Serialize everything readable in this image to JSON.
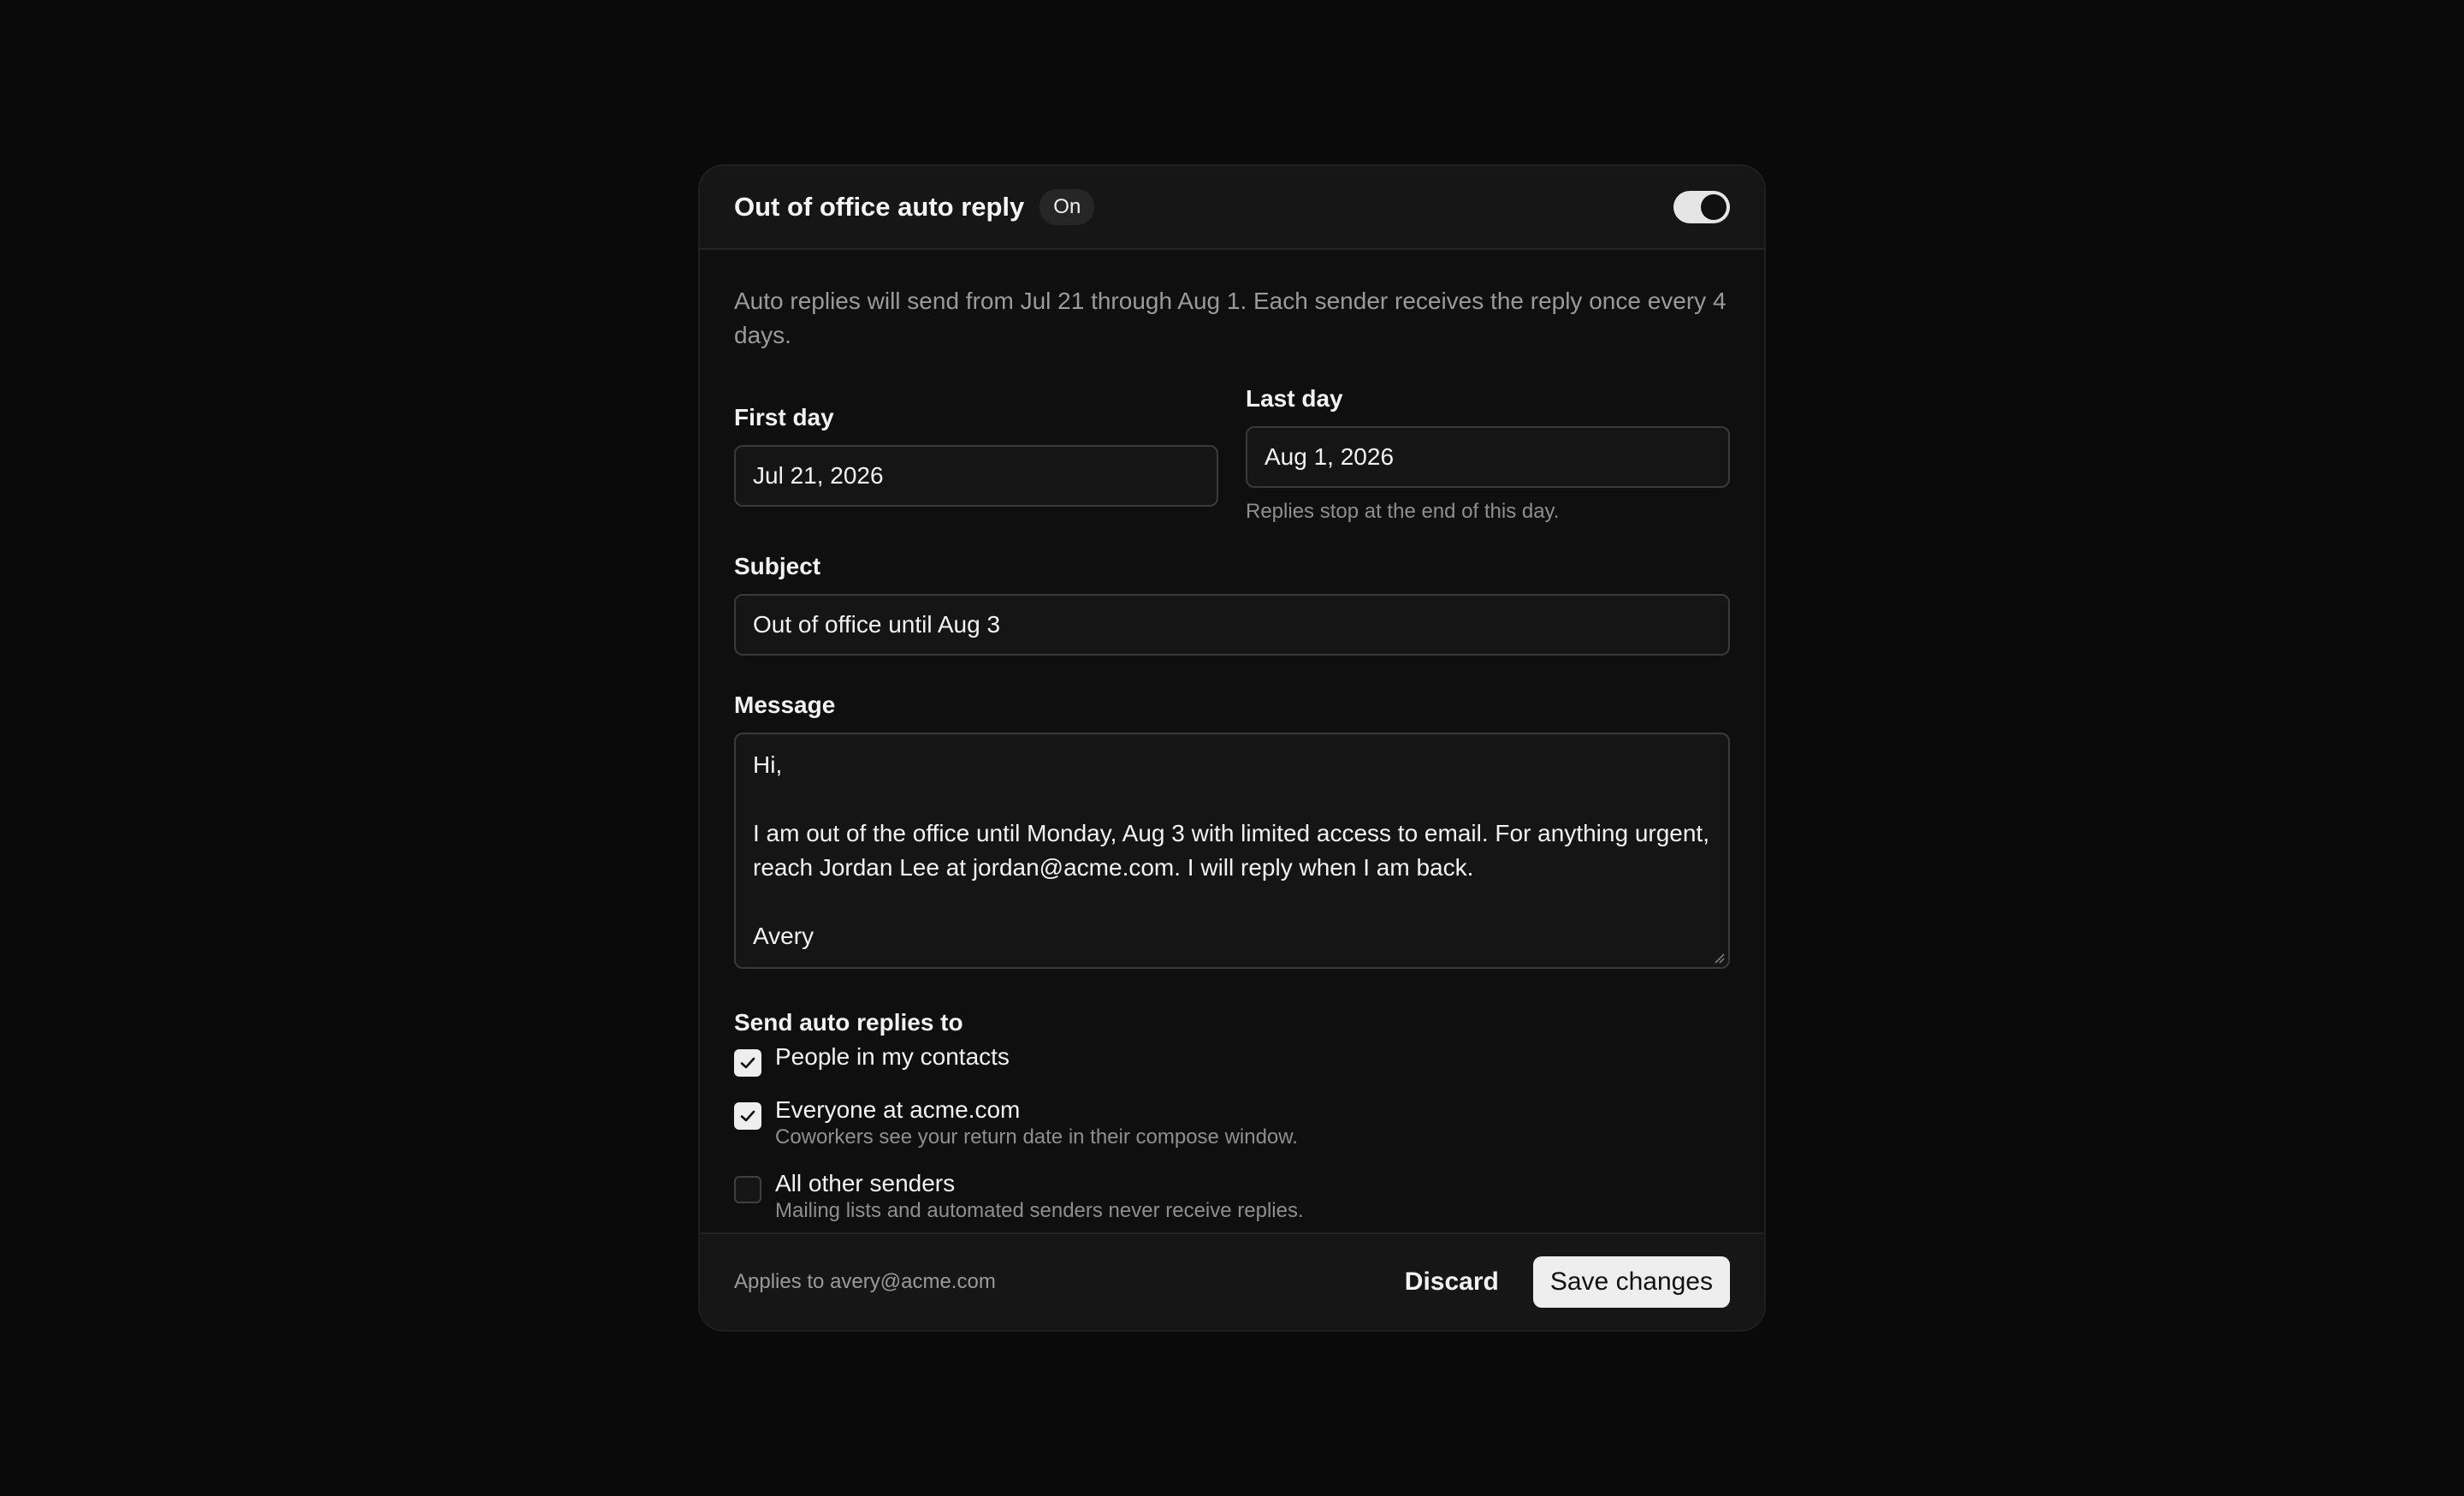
{
  "header": {
    "title": "Out of office auto reply",
    "status_badge": "On",
    "toggle_on": true
  },
  "description": "Auto replies will send from Jul 21 through Aug 1. Each sender receives the reply once every 4 days.",
  "first_day": {
    "label": "First day",
    "value": "Jul 21, 2026"
  },
  "last_day": {
    "label": "Last day",
    "value": "Aug 1, 2026",
    "hint": "Replies stop at the end of this day."
  },
  "subject": {
    "label": "Subject",
    "value": "Out of office until Aug 3"
  },
  "message": {
    "label": "Message",
    "value": "Hi,\n\nI am out of the office until Monday, Aug 3 with limited access to email. For anything urgent, reach Jordan Lee at jordan@acme.com. I will reply when I am back.\n\nAvery"
  },
  "recipients": {
    "title": "Send auto replies to",
    "options": [
      {
        "label": "People in my contacts",
        "sub": "",
        "checked": true
      },
      {
        "label": "Everyone at acme.com",
        "sub": "Coworkers see your return date in their compose window.",
        "checked": true
      },
      {
        "label": "All other senders",
        "sub": "Mailing lists and automated senders never receive replies.",
        "checked": false
      }
    ]
  },
  "footer": {
    "applies_to": "Applies to avery@acme.com",
    "discard_label": "Discard",
    "save_label": "Save changes"
  },
  "icons": {
    "check": "check-icon",
    "resize": "resize-grip-icon"
  }
}
